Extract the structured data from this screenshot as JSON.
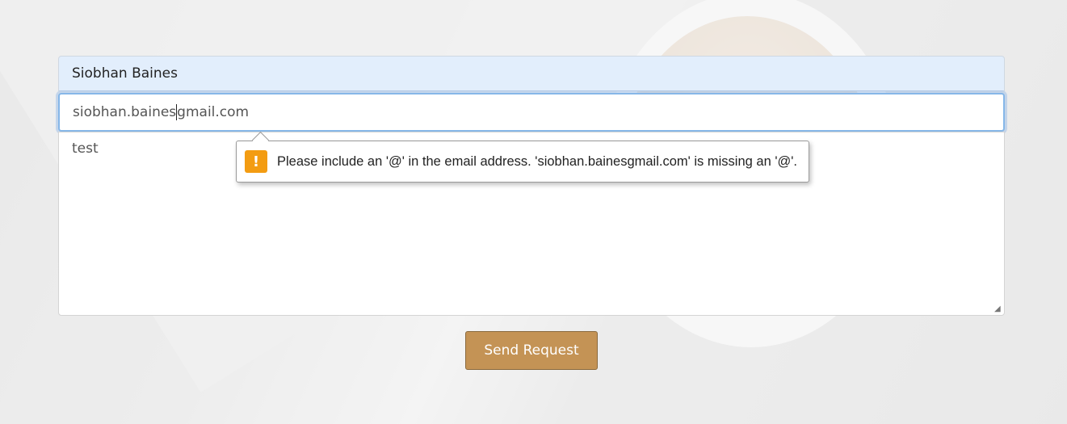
{
  "form": {
    "name_value": "Siobhan Baines",
    "email_before_caret": "siobhan.baines",
    "email_after_caret": "gmail.com",
    "message_value": "test",
    "send_label": "Send Request"
  },
  "validation": {
    "icon": "warning-icon",
    "icon_glyph": "!",
    "message": "Please include an '@' in the email address. 'siobhan.bainesgmail.com' is missing an '@'."
  },
  "colors": {
    "button": "#c49355",
    "warning": "#f39c12",
    "name_field_bg": "#e2eefc",
    "focus_ring": "#86b7e8"
  }
}
